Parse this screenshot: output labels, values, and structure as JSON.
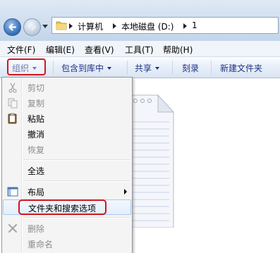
{
  "address": {
    "segments": [
      "计算机",
      "本地磁盘 (D:)",
      "1"
    ]
  },
  "menubar": [
    "文件(F)",
    "编辑(E)",
    "查看(V)",
    "工具(T)",
    "帮助(H)"
  ],
  "toolbar": {
    "organize": "组织",
    "include_in_library": "包含到库中",
    "share": "共享",
    "burn": "刻录",
    "new_folder": "新建文件夹"
  },
  "organize_menu": [
    {
      "label": "剪切",
      "icon": "scissors-icon",
      "enabled": false
    },
    {
      "label": "复制",
      "icon": "copy-icon",
      "enabled": false
    },
    {
      "label": "粘贴",
      "icon": "clipboard-icon",
      "enabled": true
    },
    {
      "label": "撤消",
      "icon": "",
      "enabled": true
    },
    {
      "label": "恢复",
      "icon": "",
      "enabled": false
    },
    {
      "label": "全选",
      "icon": "",
      "enabled": true
    },
    {
      "label": "布局",
      "icon": "layout-icon",
      "enabled": true,
      "submenu": true
    },
    {
      "label": "文件夹和搜索选项",
      "icon": "",
      "enabled": true,
      "highlighted": true
    },
    {
      "label": "删除",
      "icon": "delete-x-icon",
      "enabled": false
    },
    {
      "label": "重命名",
      "icon": "",
      "enabled": false
    }
  ],
  "colors": {
    "annotation_red": "#d0161e",
    "toolbar_text": "#1e3287"
  }
}
